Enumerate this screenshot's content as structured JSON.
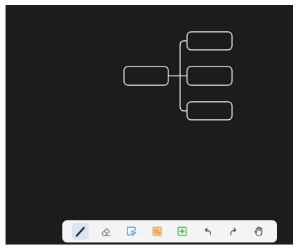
{
  "canvas": {
    "background": "#1a1c1d",
    "mindmap": {
      "root": {
        "label": ""
      },
      "children": [
        {
          "label": ""
        },
        {
          "label": ""
        },
        {
          "label": ""
        }
      ]
    }
  },
  "toolbar": {
    "active_tool": "pen",
    "tools": [
      {
        "name": "pen",
        "icon": "pen-icon",
        "color": "#1c2330"
      },
      {
        "name": "eraser",
        "icon": "eraser-icon",
        "color": "#6b6b6b"
      },
      {
        "name": "select",
        "icon": "select-icon",
        "color": "#3d86f0"
      },
      {
        "name": "sticky-note",
        "icon": "sticky-note-icon",
        "color": "#f0a23a"
      },
      {
        "name": "add-frame",
        "icon": "add-frame-icon",
        "color": "#3aa64a"
      },
      {
        "name": "undo",
        "icon": "undo-icon",
        "color": "#444444"
      },
      {
        "name": "redo",
        "icon": "redo-icon",
        "color": "#444444"
      },
      {
        "name": "pan",
        "icon": "hand-icon",
        "color": "#444444"
      }
    ]
  }
}
